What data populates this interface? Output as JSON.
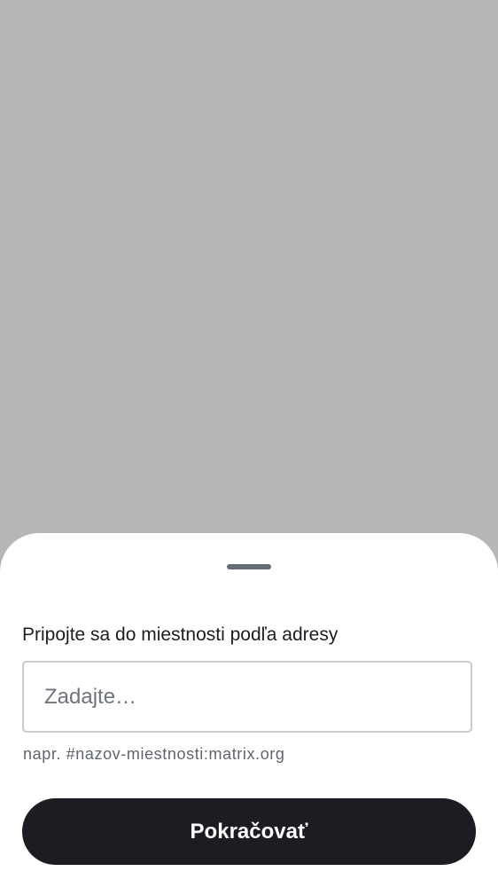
{
  "colors": {
    "scrim": "#b5b6b8",
    "sheet_background": "#ffffff",
    "handle": "#656c76",
    "text_primary": "#1b1d22",
    "text_secondary": "#60656d",
    "input_border": "#c9cbcf",
    "button_background": "#1b1d22",
    "button_text": "#ffffff"
  },
  "sheet": {
    "label": "Pripojte sa do miestnosti podľa adresy",
    "input": {
      "value": "",
      "placeholder": "Zadajte…"
    },
    "supporting_text": "napr. #nazov-miestnosti:matrix.org",
    "continue_label": "Pokračovať"
  }
}
